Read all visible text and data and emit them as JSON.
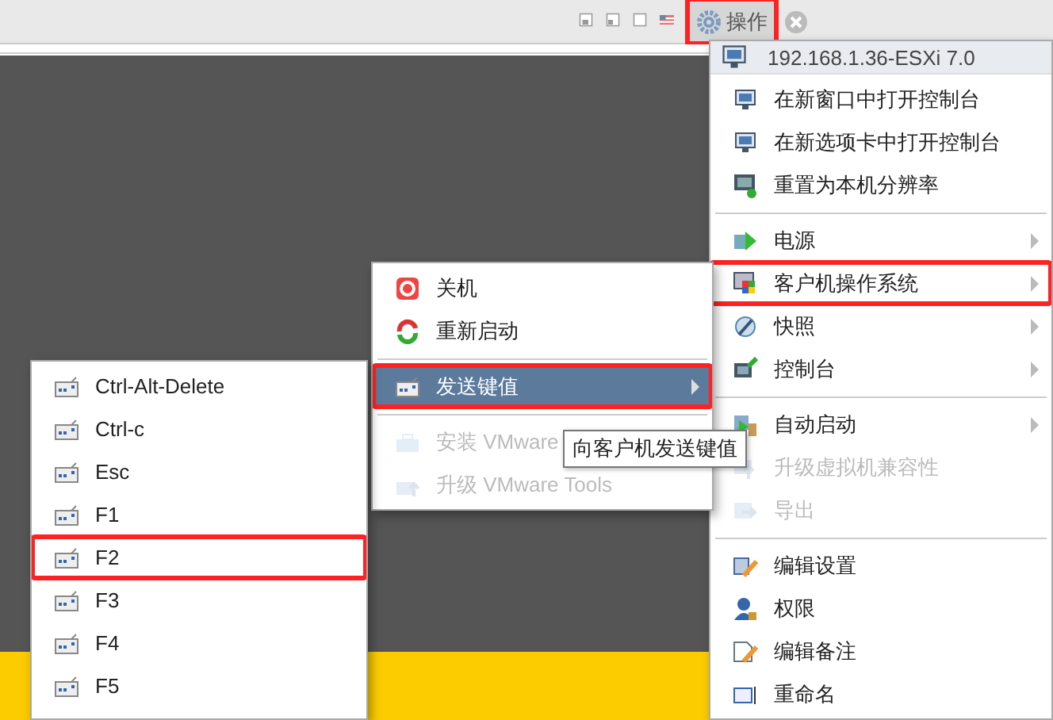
{
  "toolbar": {
    "actions_button": {
      "label": "操作",
      "highlighted": true
    }
  },
  "actions_menu": {
    "header": "192.168.1.36-ESXi 7.0",
    "groups": [
      [
        {
          "label": "在新窗口中打开控制台",
          "has_submenu": false,
          "disabled": false,
          "selected": false,
          "highlighted": false
        },
        {
          "label": "在新选项卡中打开控制台",
          "has_submenu": false,
          "disabled": false,
          "selected": false,
          "highlighted": false
        },
        {
          "label": "重置为本机分辨率",
          "has_submenu": false,
          "disabled": false,
          "selected": false,
          "highlighted": false
        }
      ],
      [
        {
          "label": "电源",
          "has_submenu": true,
          "disabled": false,
          "selected": false,
          "highlighted": false
        },
        {
          "label": "客户机操作系统",
          "has_submenu": true,
          "disabled": false,
          "selected": false,
          "highlighted": true
        },
        {
          "label": "快照",
          "has_submenu": true,
          "disabled": false,
          "selected": false,
          "highlighted": false
        },
        {
          "label": "控制台",
          "has_submenu": true,
          "disabled": false,
          "selected": false,
          "highlighted": false
        }
      ],
      [
        {
          "label": "自动启动",
          "has_submenu": true,
          "disabled": false,
          "selected": false,
          "highlighted": false
        },
        {
          "label": "升级虚拟机兼容性",
          "has_submenu": false,
          "disabled": true,
          "selected": false,
          "highlighted": false
        },
        {
          "label": "导出",
          "has_submenu": false,
          "disabled": true,
          "selected": false,
          "highlighted": false
        }
      ],
      [
        {
          "label": "编辑设置",
          "has_submenu": false,
          "disabled": false,
          "selected": false,
          "highlighted": false
        },
        {
          "label": "权限",
          "has_submenu": false,
          "disabled": false,
          "selected": false,
          "highlighted": false
        },
        {
          "label": "编辑备注",
          "has_submenu": false,
          "disabled": false,
          "selected": false,
          "highlighted": false
        },
        {
          "label": "重命名",
          "has_submenu": false,
          "disabled": false,
          "selected": false,
          "highlighted": false
        }
      ]
    ]
  },
  "guest_os_menu": {
    "groups": [
      [
        {
          "label": "关机",
          "has_submenu": false,
          "disabled": false,
          "selected": false,
          "highlighted": false
        },
        {
          "label": "重新启动",
          "has_submenu": false,
          "disabled": false,
          "selected": false,
          "highlighted": false
        }
      ],
      [
        {
          "label": "发送键值",
          "has_submenu": true,
          "disabled": false,
          "selected": true,
          "highlighted": true
        }
      ],
      [
        {
          "label": "安装 VMware",
          "has_submenu": false,
          "disabled": true,
          "selected": false,
          "highlighted": false
        },
        {
          "label": "升级 VMware Tools",
          "has_submenu": false,
          "disabled": true,
          "selected": false,
          "highlighted": false
        }
      ]
    ]
  },
  "tooltip": "向客户机发送键值",
  "keys_menu": {
    "groups": [
      [
        {
          "label": "Ctrl-Alt-Delete",
          "has_submenu": false,
          "disabled": false,
          "selected": false,
          "highlighted": false
        },
        {
          "label": "Ctrl-c",
          "has_submenu": false,
          "disabled": false,
          "selected": false,
          "highlighted": false
        },
        {
          "label": "Esc",
          "has_submenu": false,
          "disabled": false,
          "selected": false,
          "highlighted": false
        },
        {
          "label": "F1",
          "has_submenu": false,
          "disabled": false,
          "selected": false,
          "highlighted": false
        },
        {
          "label": "F2",
          "has_submenu": false,
          "disabled": false,
          "selected": false,
          "highlighted": true
        },
        {
          "label": "F3",
          "has_submenu": false,
          "disabled": false,
          "selected": false,
          "highlighted": false
        },
        {
          "label": "F4",
          "has_submenu": false,
          "disabled": false,
          "selected": false,
          "highlighted": false
        },
        {
          "label": "F5",
          "has_submenu": false,
          "disabled": false,
          "selected": false,
          "highlighted": false
        }
      ]
    ]
  }
}
